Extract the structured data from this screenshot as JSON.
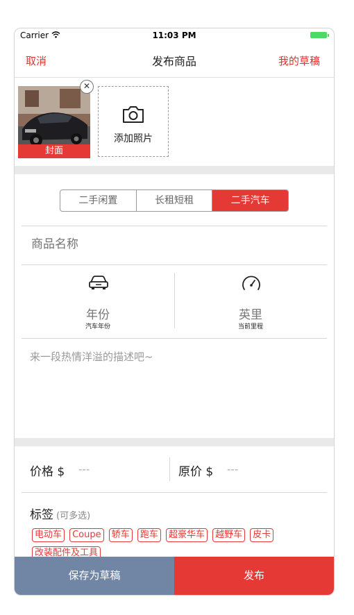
{
  "status": {
    "carrier": "Carrier",
    "time": "11:03 PM"
  },
  "nav": {
    "cancel": "取消",
    "title": "发布商品",
    "drafts": "我的草稿"
  },
  "photos": {
    "cover_label": "封面",
    "add_label": "添加照片"
  },
  "segments": [
    {
      "label": "二手闲置",
      "active": false
    },
    {
      "label": "长租短租",
      "active": false
    },
    {
      "label": "二手汽车",
      "active": true
    }
  ],
  "title_placeholder": "商品名称",
  "specs": [
    {
      "icon": "car-icon",
      "value": "年份",
      "caption": "汽车年份"
    },
    {
      "icon": "speedometer-icon",
      "value": "英里",
      "caption": "当前里程"
    }
  ],
  "description_placeholder": "来一段热情洋溢的描述吧~",
  "price": {
    "label": "价格 $",
    "value": "---",
    "original_label": "原价 $",
    "original_value": "---"
  },
  "tags": {
    "title": "标签",
    "hint": "(可多选)",
    "items": [
      "电动车",
      "Coupe",
      "轿车",
      "跑车",
      "超豪华车",
      "越野车",
      "皮卡",
      "改装配件及工具"
    ]
  },
  "actions": {
    "save_draft": "保存为草稿",
    "publish": "发布"
  },
  "colors": {
    "accent": "#e53935",
    "secondary": "#7186a5"
  }
}
